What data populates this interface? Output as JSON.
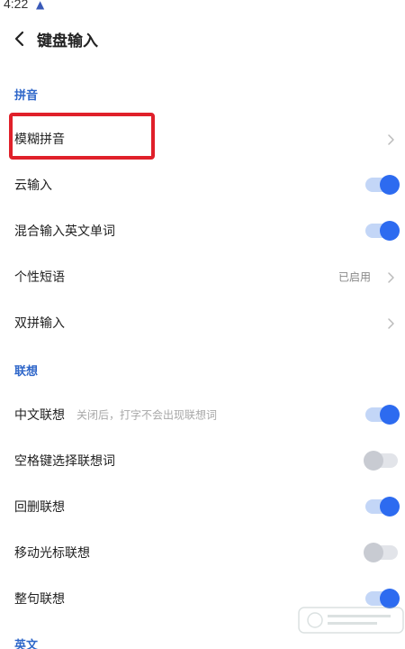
{
  "status_bar": {
    "time": "4:22",
    "notification_icon": "app-notification-icon"
  },
  "header": {
    "title": "键盘输入",
    "back_icon": "back-arrow-icon"
  },
  "sections": {
    "pinyin": "拼音",
    "association": "联想",
    "english": "英文"
  },
  "rows": {
    "fuzzy_pinyin": {
      "label": "模糊拼音"
    },
    "cloud_input": {
      "label": "云输入",
      "enabled": true
    },
    "mixed_english": {
      "label": "混合输入英文单词",
      "enabled": true
    },
    "custom_phrases": {
      "label": "个性短语",
      "value": "已启用"
    },
    "double_pinyin": {
      "label": "双拼输入"
    },
    "chinese_association": {
      "label": "中文联想",
      "hint": "关闭后，打字不会出现联想词",
      "enabled": true
    },
    "space_select": {
      "label": "空格键选择联想词",
      "enabled": false
    },
    "backspace_association": {
      "label": "回删联想",
      "enabled": true
    },
    "cursor_association": {
      "label": "移动光标联想",
      "enabled": false
    },
    "sentence_association": {
      "label": "整句联想",
      "enabled": true
    }
  },
  "colors": {
    "accent": "#2d6bf0",
    "section_title": "#2e66c9",
    "highlight": "#e0202a"
  }
}
